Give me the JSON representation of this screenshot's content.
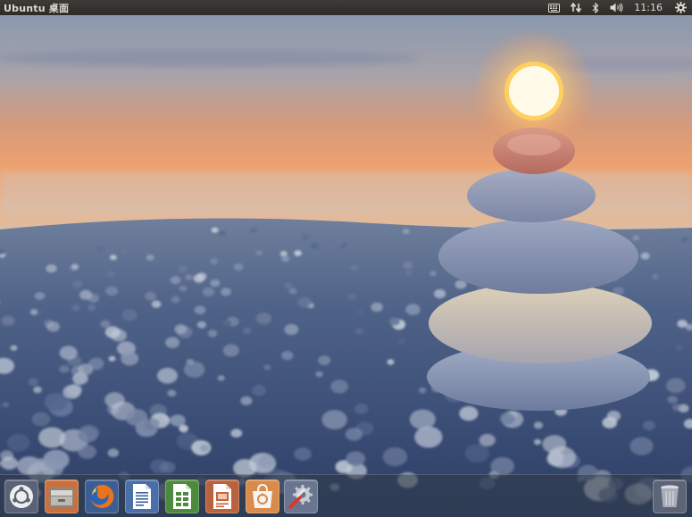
{
  "top_panel": {
    "window_title": "Ubuntu 桌面",
    "clock": "11:16",
    "indicators": [
      "keyboard-icon",
      "network-arrows-icon",
      "bluetooth-icon",
      "volume-icon",
      "session-gear-icon"
    ]
  },
  "launcher": {
    "items": [
      {
        "icon": "ubuntu-dash-icon"
      },
      {
        "icon": "files-icon"
      },
      {
        "icon": "firefox-icon"
      },
      {
        "icon": "writer-icon"
      },
      {
        "icon": "calc-icon"
      },
      {
        "icon": "impress-icon"
      },
      {
        "icon": "software-center-icon"
      },
      {
        "icon": "system-settings-icon"
      }
    ],
    "trash": {
      "icon": "trash-icon"
    }
  },
  "colors": {
    "panel_bg": "#2c2b28",
    "panel_text": "#dfdbd2",
    "sun": "#fff6d0",
    "sky_top": "#7f8fa8",
    "sky_glow": "#f6a56a"
  }
}
